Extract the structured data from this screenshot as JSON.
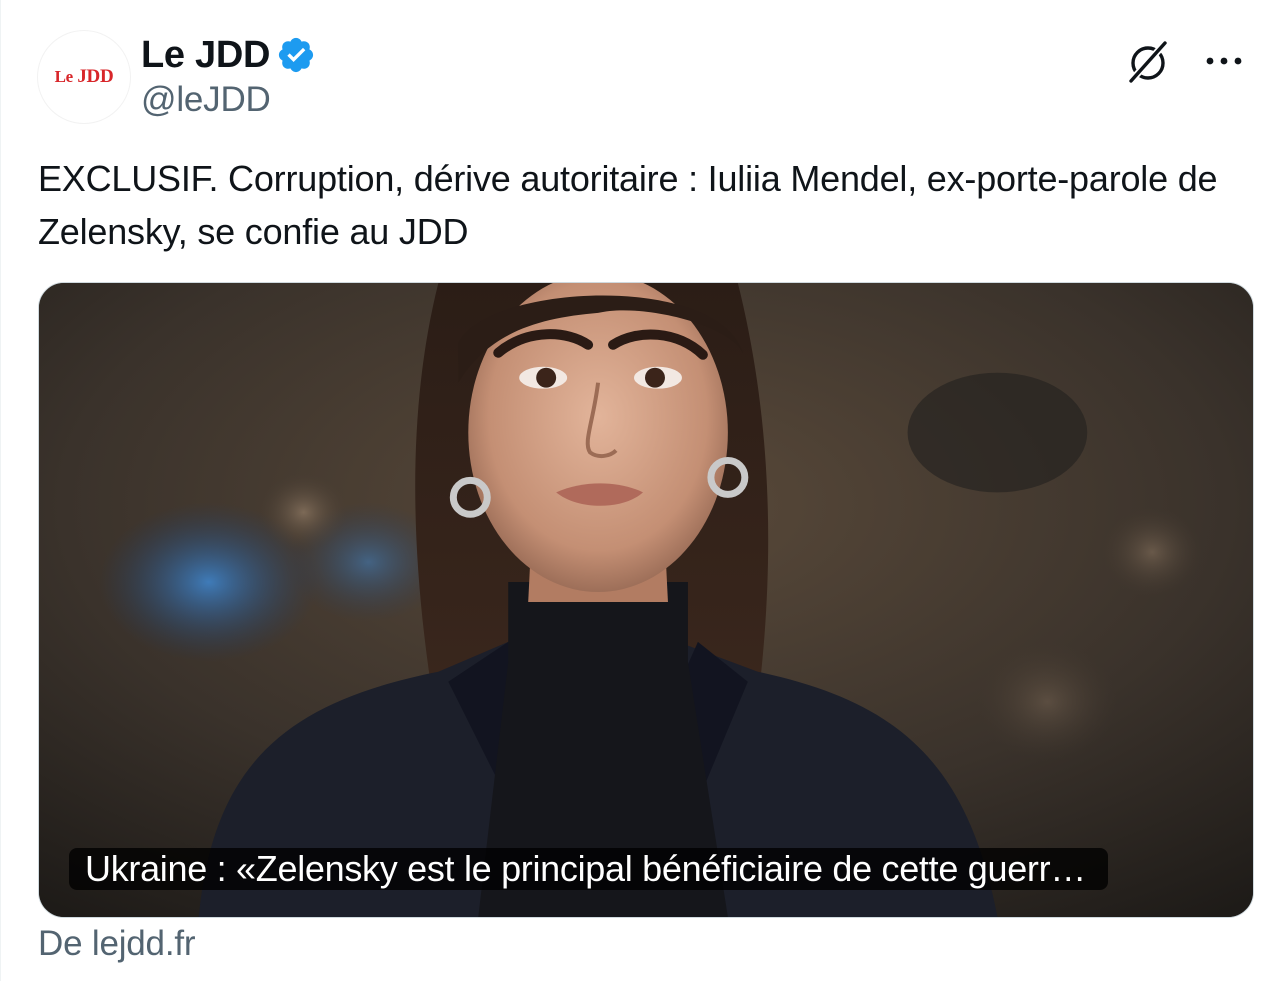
{
  "account": {
    "display_name": "Le JDD",
    "handle": "@leJDD",
    "avatar_text_small": "Le",
    "avatar_text_big": "JDD",
    "verified": true
  },
  "post": {
    "text": "EXCLUSIF. Corruption, dérive autoritaire : Iuliia Mendel, ex-porte-parole de Zelensky, se confie au JDD"
  },
  "card": {
    "caption": "Ukraine : «Zelensky est le principal bénéficiaire de cette guerr…",
    "source": "De lejdd.fr"
  },
  "icons": {
    "verified": "verified-badge-icon",
    "grok": "grok-icon",
    "more": "more-options-icon"
  },
  "colors": {
    "verified_blue": "#1d9bf0",
    "text_primary": "#0f1419",
    "text_secondary": "#536471",
    "brand_red": "#d8262a"
  }
}
